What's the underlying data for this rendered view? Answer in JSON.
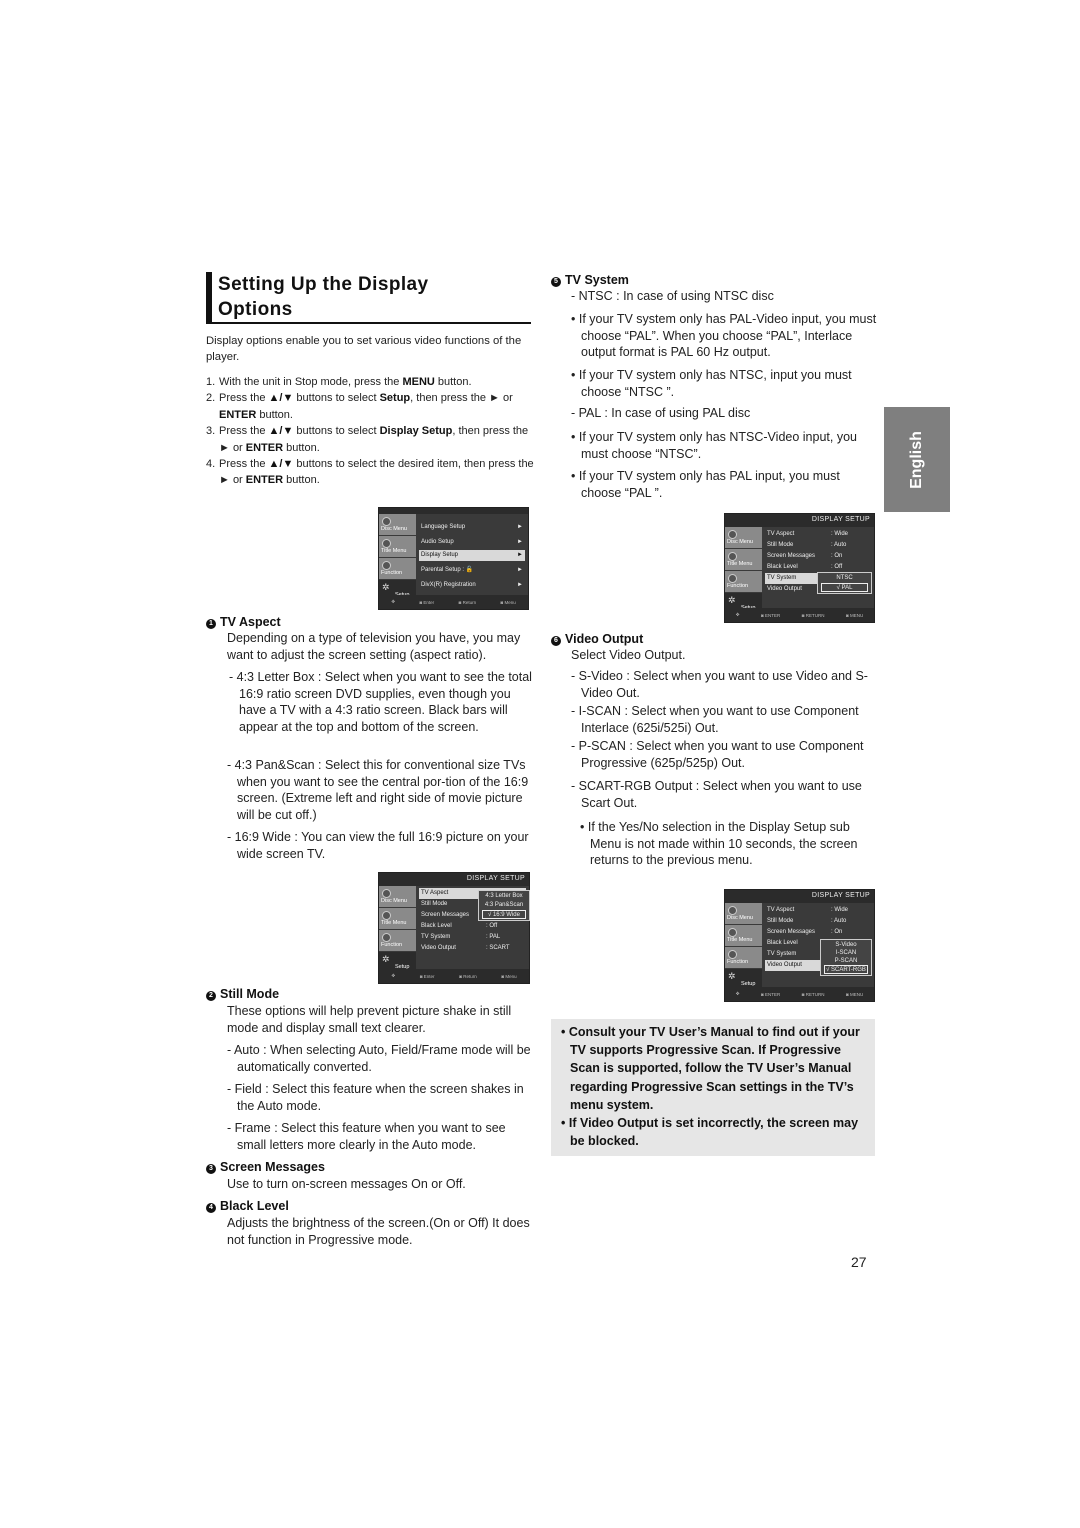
{
  "title": "Setting Up the Display Options",
  "title_lines": [
    "Setting Up the Display",
    "Options"
  ],
  "intro": "Display options enable you to set various video functions of the player.",
  "steps": [
    {
      "num": "1.",
      "html_parts": [
        "With the unit in Stop mode, press the ",
        "MENU",
        " button."
      ]
    },
    {
      "num": "2.",
      "text": "Press the ▲/▼ buttons to select Setup, then press the ► or ENTER button."
    },
    {
      "num": "3.",
      "text": "Press the ▲/▼ buttons to select Display Setup, then press the ► or ENTER button."
    },
    {
      "num": "4.",
      "text": "Press the ▲/▼ buttons to select the desired item, then press the ► or ENTER button."
    }
  ],
  "steps_display": {
    "s1": {
      "a": "With the unit in Stop mode, press the ",
      "b": "MENU",
      "c": " button."
    },
    "s2": {
      "a": "Press the ",
      "b": "▲/▼",
      "c": " buttons to select ",
      "d": "Setup",
      "e": ", then press the ► or ",
      "f": "ENTER",
      "g": " button."
    },
    "s3": {
      "a": "Press the ",
      "b": "▲/▼",
      "c": " buttons to select ",
      "d": "Display Setup",
      "e": ", then press the ► or ",
      "f": "ENTER",
      "g": " button."
    },
    "s4": {
      "a": "Press the ",
      "b": "▲/▼",
      "c": " buttons to select the desired item, then press the ► or ",
      "f": "ENTER",
      "g": " button."
    }
  },
  "osd_tabs": [
    "Disc Menu",
    "Title Menu",
    "Function",
    "Setup"
  ],
  "osd_footer_small": [
    "Enter",
    "Return",
    "Menu"
  ],
  "osd_footer_caps": [
    "ENTER",
    "RETURN",
    "MENU"
  ],
  "osd_setup_menu": {
    "items": [
      {
        "label": "Language Setup",
        "arrow": "►"
      },
      {
        "label": "Audio Setup",
        "arrow": "►"
      },
      {
        "label": "Display Setup",
        "arrow": "►",
        "highlighted": true
      },
      {
        "label": "Parental Setup :",
        "arrow": "►"
      },
      {
        "label": "DivX(R) Registration",
        "arrow": "►"
      }
    ]
  },
  "osd_display_header": "DISPLAY SETUP",
  "osd_display_1": {
    "rows": [
      {
        "label": "TV Aspect",
        "value": ""
      },
      {
        "label": "Still Mode",
        "value": ""
      },
      {
        "label": "Screen Messages",
        "value": ""
      },
      {
        "label": "Black Level",
        "value": ": Off"
      },
      {
        "label": "TV System",
        "value": ": PAL"
      },
      {
        "label": "Video Output",
        "value": ": SCART"
      }
    ],
    "popup": [
      "4:3 Letter Box",
      "4:3 Pan&Scan",
      "√ 16:9 Wide"
    ]
  },
  "osd_display_2": {
    "rows": [
      {
        "label": "TV Aspect",
        "value": ": Wide"
      },
      {
        "label": "Still Mode",
        "value": ": Auto"
      },
      {
        "label": "Screen Messages",
        "value": ": On"
      },
      {
        "label": "Black Level",
        "value": ": Off"
      },
      {
        "label": "TV System",
        "value": ""
      },
      {
        "label": "Video Output",
        "value": ""
      }
    ],
    "popup": [
      "NTSC",
      "√  PAL"
    ]
  },
  "osd_display_3": {
    "rows": [
      {
        "label": "TV Aspect",
        "value": ": Wide"
      },
      {
        "label": "Still Mode",
        "value": ": Auto"
      },
      {
        "label": "Screen Messages",
        "value": ": On"
      },
      {
        "label": "Black Level",
        "value": ""
      },
      {
        "label": "TV System",
        "value": ""
      },
      {
        "label": "Video Output",
        "value": ""
      }
    ],
    "popup": [
      "S-Video",
      "I-SCAN",
      "P-SCAN",
      "√ SCART-RGB"
    ]
  },
  "sections": {
    "tv_aspect": {
      "num": "1",
      "heading": "TV Aspect",
      "desc": "Depending on a type of television you have, you may want to adjust the screen setting (aspect ratio).",
      "items": [
        "- 4:3 Letter Box : Select when you want to see the total 16:9 ratio screen DVD supplies, even though you have a TV with a 4:3 ratio screen. Black bars will appear at the top and bottom of the screen.",
        "- 4:3 Pan&Scan : Select this for conventional size TVs when you want to see the central por-tion of the 16:9 screen. (Extreme left and right side of movie picture will be cut off.)",
        "- 16:9 Wide : You can view the full 16:9 picture on your wide screen TV."
      ]
    },
    "still_mode": {
      "num": "2",
      "heading": "Still Mode",
      "desc": "These options will help prevent picture shake in still mode and display small text clearer.",
      "items": [
        "- Auto : When selecting Auto, Field/Frame mode will be automatically converted.",
        "- Field : Select this feature when the screen shakes in the Auto mode.",
        "- Frame : Select this feature when you want to see small letters more clearly in the Auto mode."
      ]
    },
    "screen_messages": {
      "num": "3",
      "heading": "Screen Messages",
      "desc": "Use to turn on-screen messages On or Off."
    },
    "black_level": {
      "num": "4",
      "heading": "Black Level",
      "desc": "Adjusts the brightness of the screen.(On or Off) It does not function in Progressive mode."
    },
    "tv_system": {
      "num": "5",
      "heading": "TV System",
      "items": [
        "- NTSC : In case of using NTSC disc",
        "• If your TV system only has PAL-Video input, you must choose “PAL”. When you choose “PAL”, Interlace output format is PAL 60 Hz output.",
        "• If your TV system only has NTSC, input you must choose “NTSC ”.",
        "- PAL : In case of using PAL disc",
        "• If your TV system only has NTSC-Video input, you must choose “NTSC”.",
        "• If your TV system only has PAL input, you must choose “PAL ”."
      ]
    },
    "video_output": {
      "num": "6",
      "heading": "Video Output",
      "desc": "Select Video Output.",
      "items": [
        "- S-Video : Select when you want to use Video and S-Video Out.",
        "- I-SCAN : Select when you want to use Component Interlace (625i/525i) Out.",
        "- P-SCAN : Select when you want to use Component Progressive (625p/525p) Out.",
        "- SCART-RGB Output : Select when you want to use Scart Out.",
        "• If the Yes/No selection in the Display Setup sub Menu is not made within 10 seconds, the screen returns to the previous menu."
      ]
    }
  },
  "notes": [
    "• Consult your TV User’s Manual to find out if your TV supports Progressive Scan. If Progressive Scan is supported, follow the TV User’s Manual regarding Progressive Scan settings in the TV’s menu system.",
    "• If Video Output is set incorrectly, the screen may be blocked."
  ],
  "language_tab": "English",
  "page_number": "27"
}
